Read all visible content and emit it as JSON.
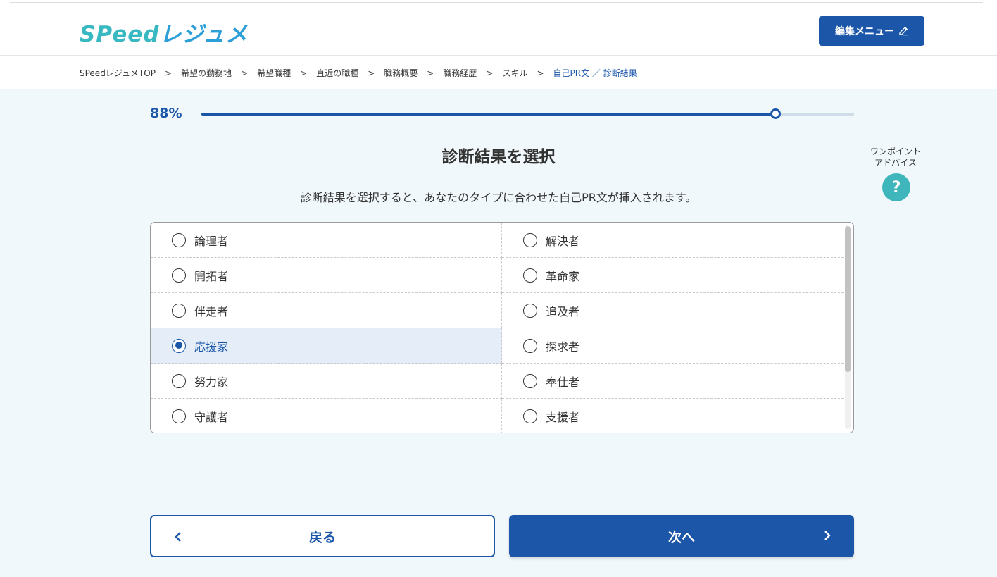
{
  "logo": {
    "latin": "SPeed",
    "kana": "レジュメ"
  },
  "header": {
    "edit_menu_label": "編集メニュー"
  },
  "breadcrumb": [
    "SPeedレジュメTOP",
    "希望の勤務地",
    "希望職種",
    "直近の職種",
    "職務概要",
    "職務経歴",
    "スキル",
    "自己PR文 ／ 診断結果"
  ],
  "progress": {
    "label": "88%",
    "value": 0.88
  },
  "page": {
    "title": "診断結果を選択",
    "subtitle": "診断結果を選択すると、あなたのタイプに合わせた自己PR文が挿入されます。"
  },
  "advice": {
    "line1": "ワンポイント",
    "line2": "アドバイス",
    "button": "?"
  },
  "options": [
    {
      "left": "論理者",
      "right": "解決者"
    },
    {
      "left": "開拓者",
      "right": "革命家"
    },
    {
      "left": "伴走者",
      "right": "追及者"
    },
    {
      "left": "応援家",
      "right": "探求者"
    },
    {
      "left": "努力家",
      "right": "奉仕者"
    },
    {
      "left": "守護者",
      "right": "支援者"
    }
  ],
  "selected_option": "応援家",
  "nav": {
    "back_label": "戻る",
    "next_label": "次へ"
  },
  "colors": {
    "primary": "#1b56a9",
    "accent_teal": "#3fb6bb",
    "background": "#f1f8fb"
  }
}
